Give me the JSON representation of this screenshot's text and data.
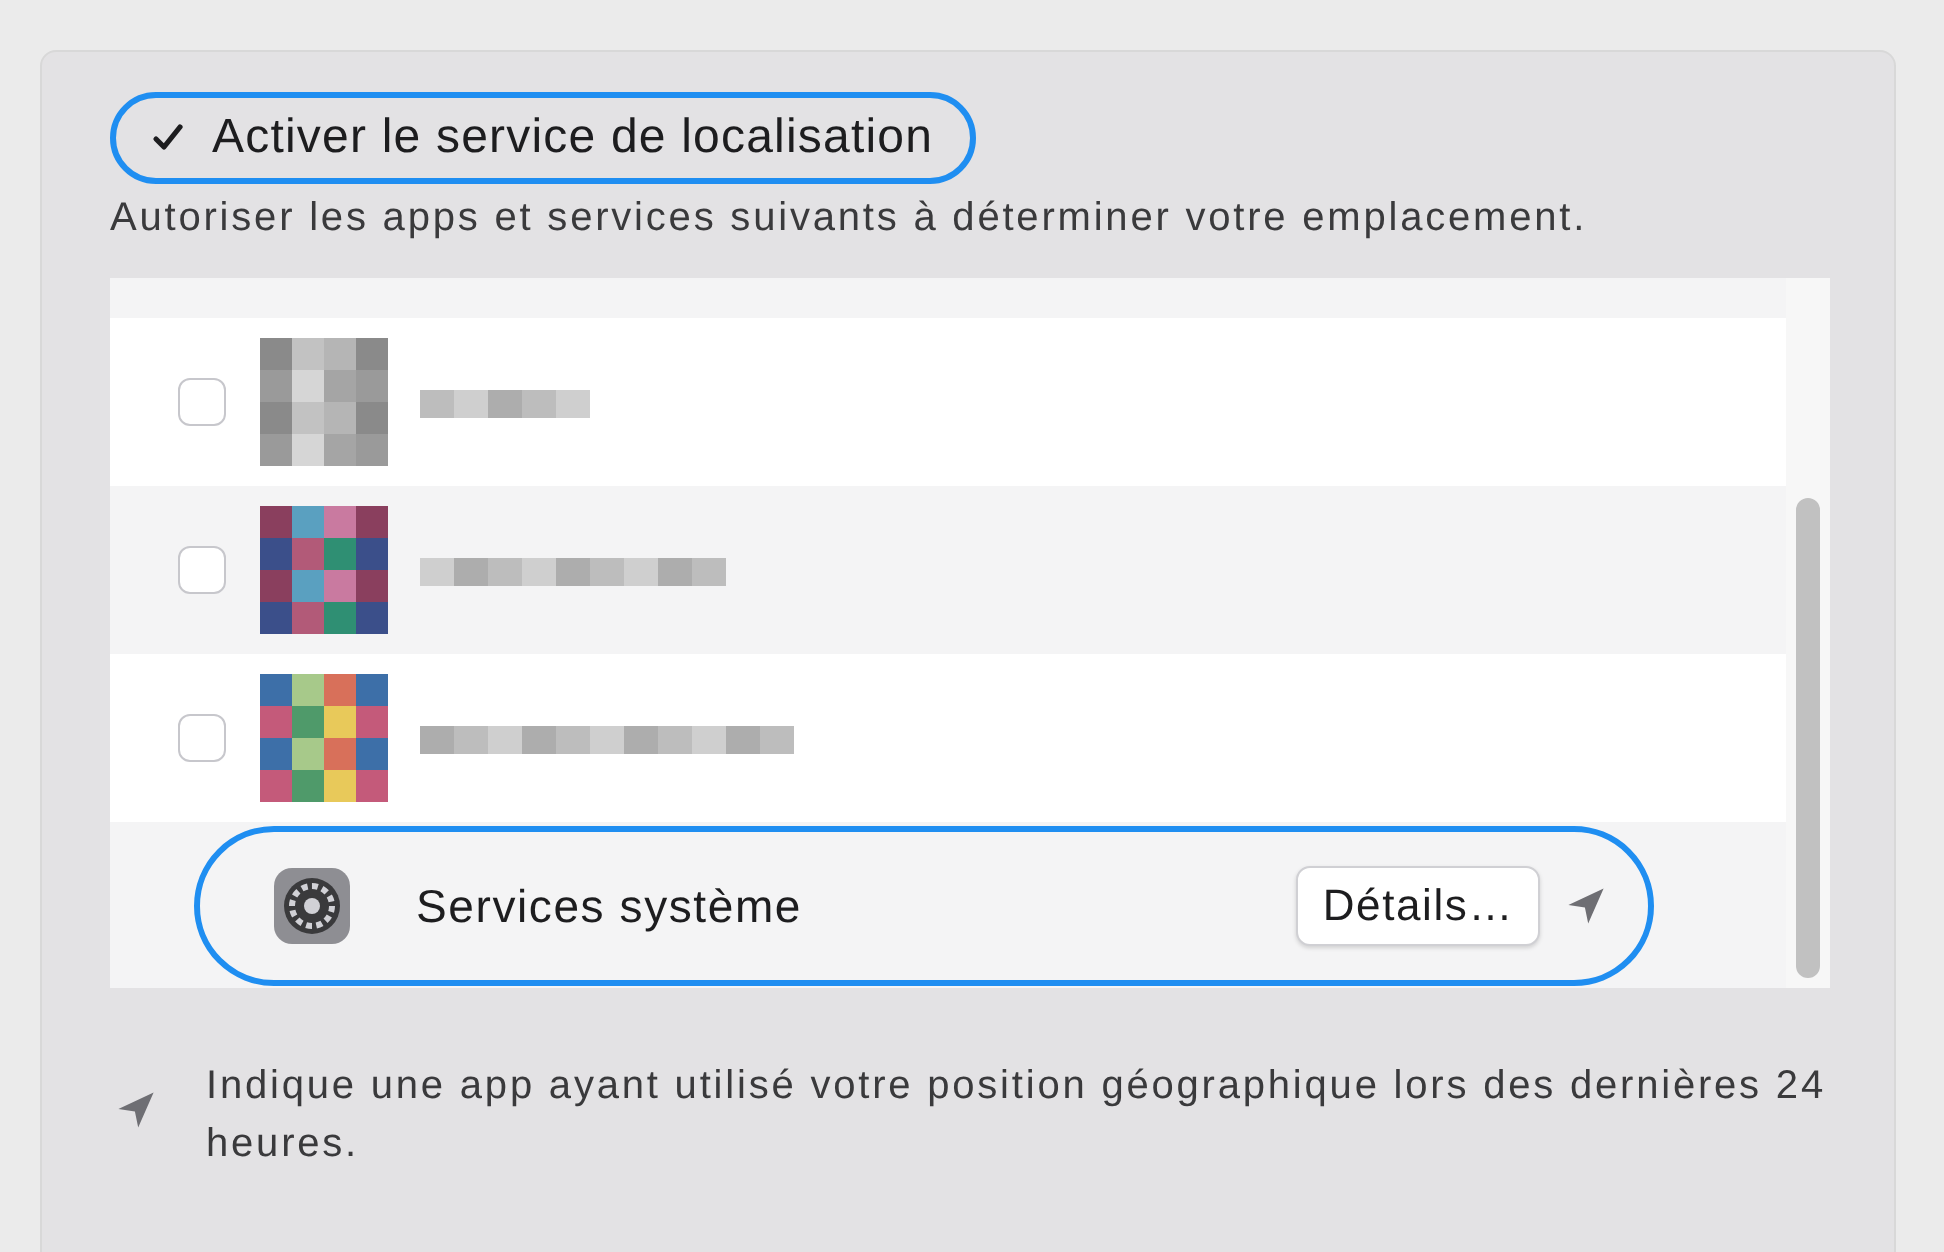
{
  "location_service": {
    "label": "Activer le service de localisation",
    "checked": true,
    "highlighted": true
  },
  "description": "Autoriser les apps et services suivants à déterminer votre emplacement.",
  "apps": [
    {
      "kind": "blurred",
      "checked": false
    },
    {
      "kind": "blurred",
      "checked": false
    },
    {
      "kind": "blurred",
      "checked": false
    },
    {
      "kind": "system",
      "name": "Services système",
      "button": "Détails…",
      "recent": true,
      "highlighted": true
    }
  ],
  "footnote": "Indique une app ayant utilisé votre position géographique lors des dernières 24 heures."
}
